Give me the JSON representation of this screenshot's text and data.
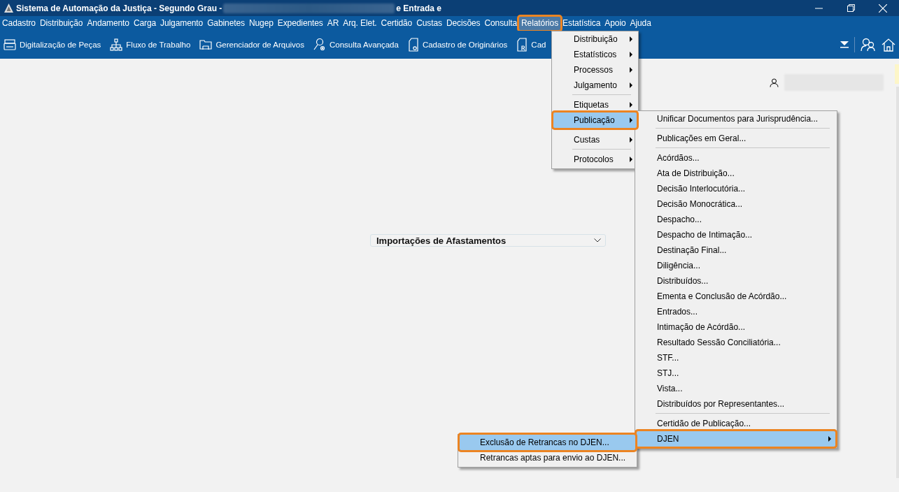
{
  "window": {
    "title": "Sistema de Automação da Justiça - Segundo Grau -",
    "title_suffix": "e Entrada e"
  },
  "menu_bar": [
    {
      "label": "Cadastro",
      "selected": false
    },
    {
      "label": "Distribuição",
      "selected": false
    },
    {
      "label": "Andamento",
      "selected": false
    },
    {
      "label": "Carga",
      "selected": false
    },
    {
      "label": "Julgamento",
      "selected": false
    },
    {
      "label": "Gabinetes",
      "selected": false
    },
    {
      "label": "Nugep",
      "selected": false
    },
    {
      "label": "Expedientes",
      "selected": false
    },
    {
      "label": "AR",
      "selected": false
    },
    {
      "label": "Arq. Elet.",
      "selected": false
    },
    {
      "label": "Certidão",
      "selected": false
    },
    {
      "label": "Custas",
      "selected": false
    },
    {
      "label": "Decisões",
      "selected": false
    },
    {
      "label": "Consulta",
      "selected": false
    },
    {
      "label": "Relatórios",
      "selected": true
    },
    {
      "label": "Estatística",
      "selected": false
    },
    {
      "label": "Apoio",
      "selected": false
    },
    {
      "label": "Ajuda",
      "selected": false
    }
  ],
  "toolbar": [
    {
      "label": "Digitalização de Peças"
    },
    {
      "label": "Fluxo de Trabalho"
    },
    {
      "label": "Gerenciador de Arquivos"
    },
    {
      "label": "Consulta Avançada"
    },
    {
      "label": "Cadastro de Originários"
    },
    {
      "label": "Cad"
    }
  ],
  "content": {
    "dropdown": {
      "value": "Importações de Afastamentos"
    }
  },
  "menus": [
    {
      "items": [
        {
          "kind": "item",
          "label": "Distribuição",
          "submenu": true,
          "selected": false
        },
        {
          "kind": "item",
          "label": "Estatísticos",
          "submenu": true,
          "selected": false
        },
        {
          "kind": "item",
          "label": "Processos",
          "submenu": true,
          "selected": false
        },
        {
          "kind": "item",
          "label": "Julgamento",
          "submenu": true,
          "selected": false
        },
        {
          "kind": "separator"
        },
        {
          "kind": "item",
          "label": "Etiquetas",
          "submenu": true,
          "selected": false
        },
        {
          "kind": "item",
          "label": "Publicação",
          "submenu": true,
          "selected": true
        },
        {
          "kind": "separator"
        },
        {
          "kind": "item",
          "label": "Custas",
          "submenu": true,
          "selected": false
        },
        {
          "kind": "separator"
        },
        {
          "kind": "item",
          "label": "Protocolos",
          "submenu": true,
          "selected": false
        }
      ]
    },
    {
      "items": [
        {
          "kind": "item",
          "label": "Unificar Documentos para Jurisprudência...",
          "submenu": false,
          "selected": false
        },
        {
          "kind": "separator"
        },
        {
          "kind": "item",
          "label": "Publicações em Geral...",
          "submenu": false,
          "selected": false
        },
        {
          "kind": "separator"
        },
        {
          "kind": "item",
          "label": "Acórdãos...",
          "submenu": false,
          "selected": false
        },
        {
          "kind": "item",
          "label": "Ata de Distribuição...",
          "submenu": false,
          "selected": false
        },
        {
          "kind": "item",
          "label": "Decisão Interlocutória...",
          "submenu": false,
          "selected": false
        },
        {
          "kind": "item",
          "label": "Decisão Monocrática...",
          "submenu": false,
          "selected": false
        },
        {
          "kind": "item",
          "label": "Despacho...",
          "submenu": false,
          "selected": false
        },
        {
          "kind": "item",
          "label": "Despacho de Intimação...",
          "submenu": false,
          "selected": false
        },
        {
          "kind": "item",
          "label": "Destinação Final...",
          "submenu": false,
          "selected": false
        },
        {
          "kind": "item",
          "label": "Diligência...",
          "submenu": false,
          "selected": false
        },
        {
          "kind": "item",
          "label": "Distribuídos...",
          "submenu": false,
          "selected": false
        },
        {
          "kind": "item",
          "label": "Ementa e Conclusão de Acórdão...",
          "submenu": false,
          "selected": false
        },
        {
          "kind": "item",
          "label": "Entrados...",
          "submenu": false,
          "selected": false
        },
        {
          "kind": "item",
          "label": "Intimação de Acórdão...",
          "submenu": false,
          "selected": false
        },
        {
          "kind": "item",
          "label": "Resultado Sessão Conciliatória...",
          "submenu": false,
          "selected": false
        },
        {
          "kind": "item",
          "label": "STF...",
          "submenu": false,
          "selected": false
        },
        {
          "kind": "item",
          "label": "STJ...",
          "submenu": false,
          "selected": false
        },
        {
          "kind": "item",
          "label": "Vista...",
          "submenu": false,
          "selected": false
        },
        {
          "kind": "item",
          "label": "Distribuídos por Representantes...",
          "submenu": false,
          "selected": false
        },
        {
          "kind": "separator"
        },
        {
          "kind": "item",
          "label": "Certidão de Publicação...",
          "submenu": false,
          "selected": false
        },
        {
          "kind": "item",
          "label": "DJEN",
          "submenu": true,
          "selected": true
        }
      ]
    },
    {
      "items": [
        {
          "kind": "item",
          "label": "Exclusão de Retrancas no DJEN...",
          "submenu": false,
          "selected": true
        },
        {
          "kind": "item",
          "label": "Retrancas aptas para envio ao DJEN...",
          "submenu": false,
          "selected": false
        }
      ]
    }
  ]
}
